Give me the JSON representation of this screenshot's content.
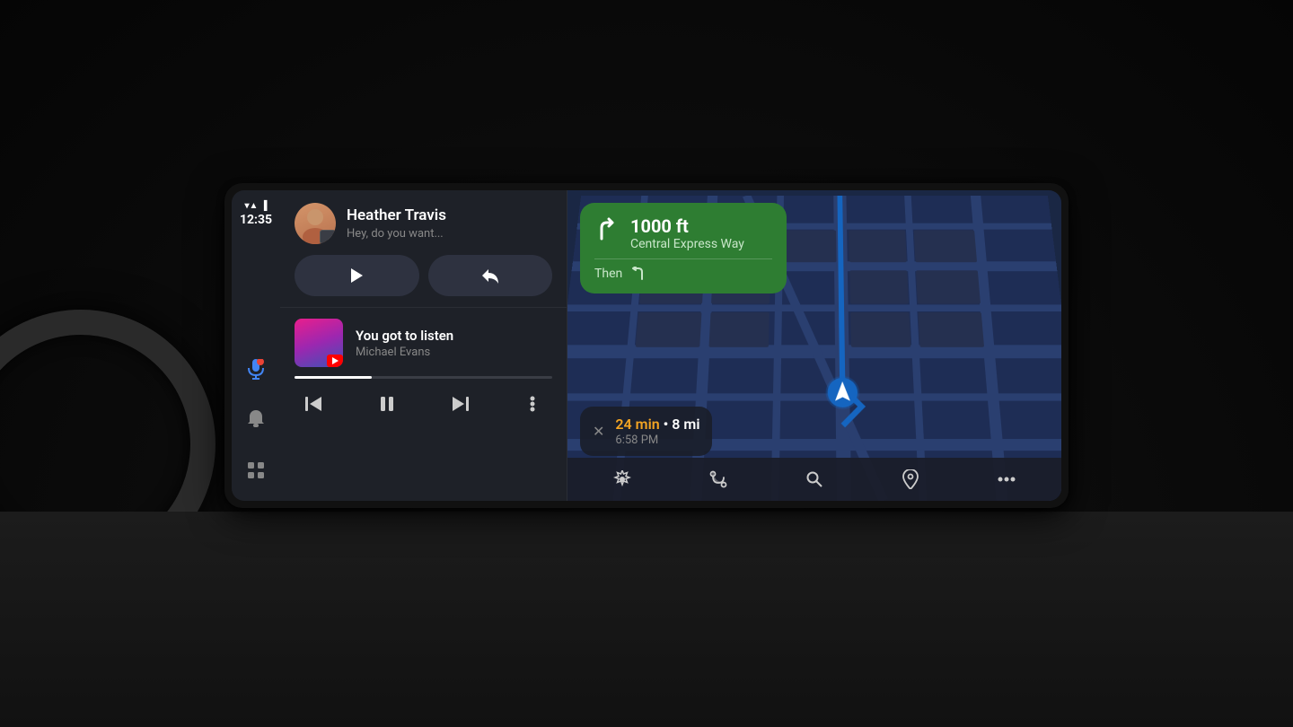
{
  "screen": {
    "status_bar": {
      "time": "12:35",
      "wifi": "▾",
      "signal": "▲",
      "battery": "▐"
    },
    "message": {
      "contact_name": "Heather Travis",
      "preview": "Hey, do you want...",
      "play_label": "▶",
      "reply_label": "↩"
    },
    "music": {
      "song_title": "You got to listen",
      "artist": "Michael Evans",
      "progress": 30
    },
    "navigation": {
      "distance": "1000 ft",
      "street": "Central Express Way",
      "then_label": "Then",
      "then_arrow": "↩"
    },
    "eta": {
      "minutes": "24 min",
      "distance": "8 mi",
      "arrival": "6:58 PM"
    },
    "controls": {
      "prev_label": "⏮",
      "pause_label": "⏸",
      "next_label": "⏭",
      "more_label": "⋮",
      "settings_label": "⚙",
      "route_label": "⑂",
      "search_label": "🔍",
      "pin_label": "📍",
      "overflow_label": "⋯"
    },
    "sidebar": {
      "mic_label": "🎤",
      "bell_label": "🔔",
      "grid_label": "⊞"
    }
  }
}
